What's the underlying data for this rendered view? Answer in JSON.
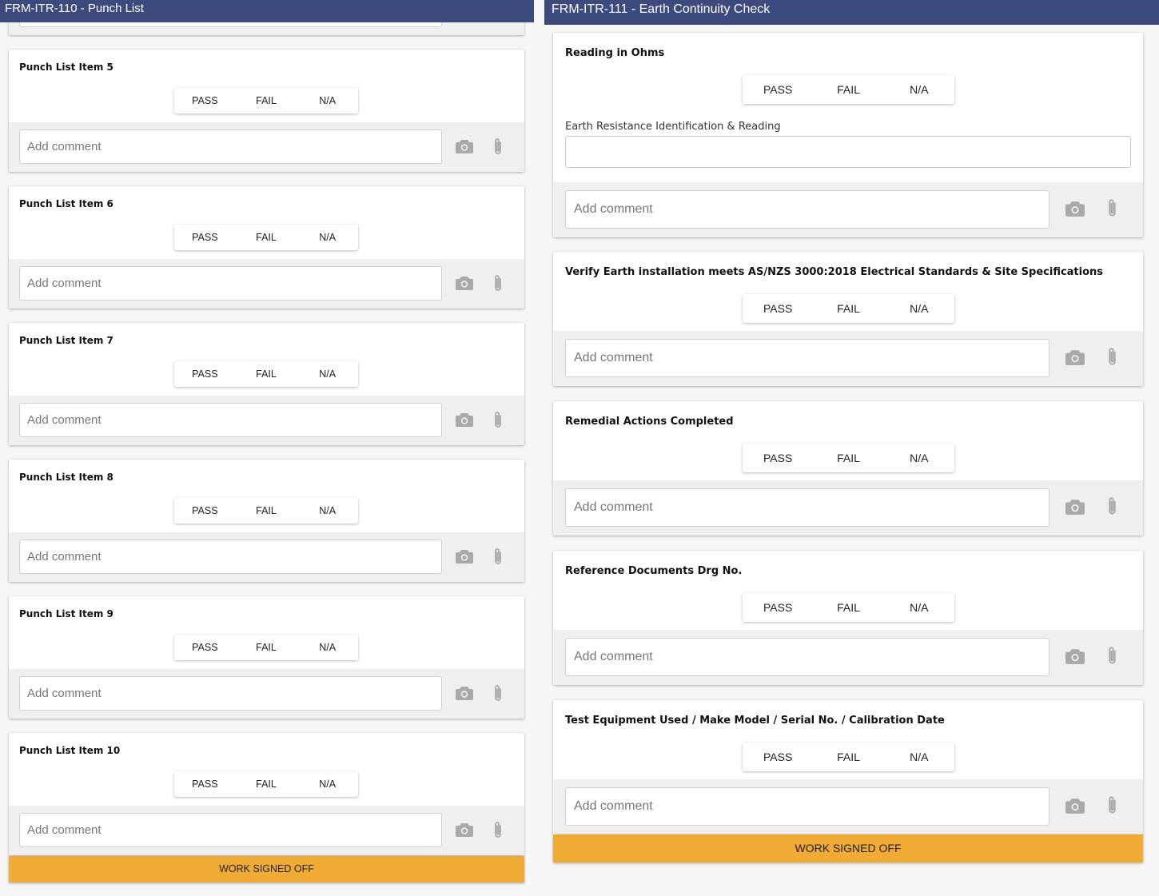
{
  "left": {
    "title": "FRM-ITR-110 - Punch List",
    "items": [
      {
        "title": "Punch List Item 5"
      },
      {
        "title": "Punch List Item 6"
      },
      {
        "title": "Punch List Item 7"
      },
      {
        "title": "Punch List Item 8"
      },
      {
        "title": "Punch List Item 9"
      },
      {
        "title": "Punch List Item 10"
      }
    ],
    "signoff": "WORK SIGNED OFF"
  },
  "right": {
    "title": "FRM-ITR-111 - Earth Continuity Check",
    "items": [
      {
        "title": "Reading in Ohms",
        "field_label": "Earth Resistance Identification & Reading",
        "field_value": ""
      },
      {
        "title": "Verify Earth installation meets AS/NZS 3000:2018 Electrical Standards & Site Specifications"
      },
      {
        "title": "Remedial Actions Completed"
      },
      {
        "title": "Reference Documents Drg No."
      },
      {
        "title": "Test Equipment Used / Make Model / Serial No. / Calibration Date"
      }
    ],
    "signoff": "WORK SIGNED OFF"
  },
  "options": {
    "pass": "PASS",
    "fail": "FAIL",
    "na": "N/A"
  },
  "comment_placeholder": "Add comment",
  "icons": {
    "camera": "camera-icon",
    "attach": "paperclip-icon"
  },
  "colors": {
    "header": "#3d4a7d",
    "signoff": "#efab34",
    "comment_bg": "#efefef"
  }
}
